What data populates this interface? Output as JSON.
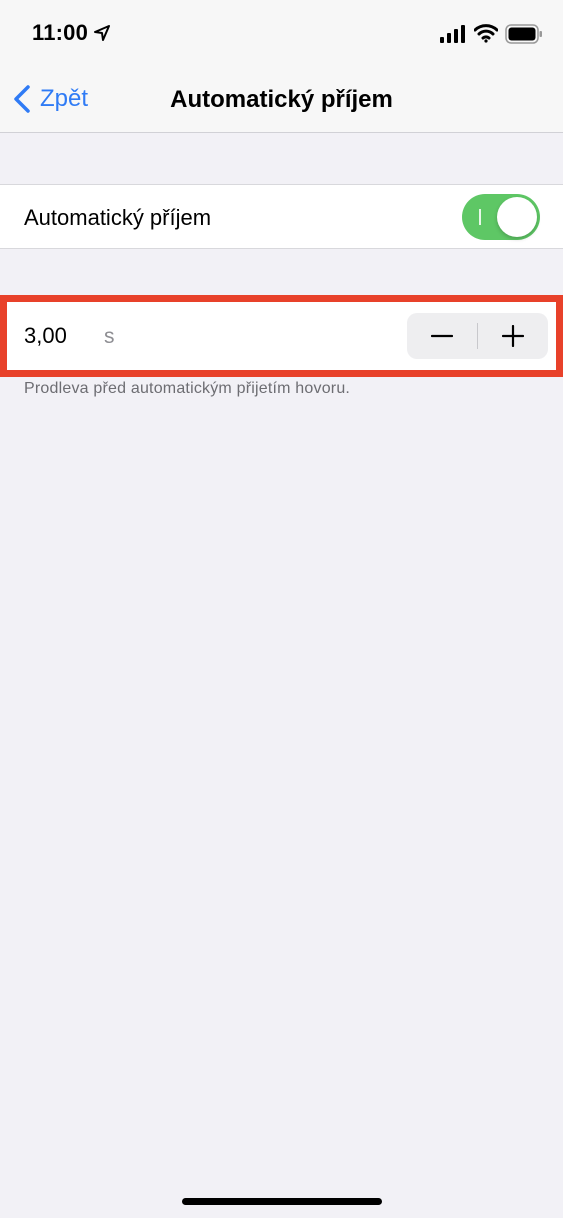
{
  "status_bar": {
    "time": "11:00",
    "location_icon": "location-arrow-icon",
    "signal_icon": "cellular-signal-icon",
    "wifi_icon": "wifi-icon",
    "battery_icon": "battery-icon"
  },
  "nav": {
    "back_label": "Zpět",
    "back_icon": "chevron-left-icon",
    "title": "Automatický příjem"
  },
  "toggle_row": {
    "label": "Automatický příjem",
    "enabled": true,
    "on_color": "#5ec765"
  },
  "delay_stepper": {
    "value": "3,00",
    "unit": "s",
    "minus_icon": "minus-icon",
    "plus_icon": "plus-icon",
    "footnote": "Prodleva před automatickým přijetím hovoru."
  },
  "colors": {
    "accent": "#2f7bf5",
    "highlight_border": "#e8412a",
    "background": "#f2f1f6"
  }
}
